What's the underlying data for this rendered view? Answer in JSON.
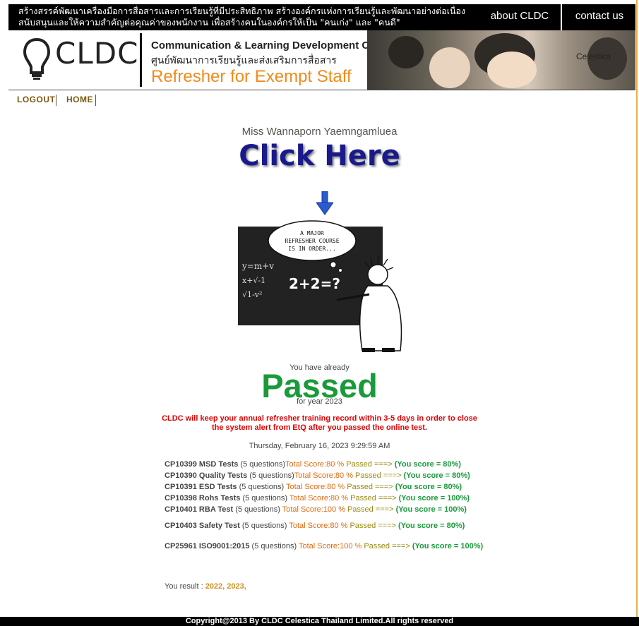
{
  "topbar": {
    "slogan_line1": "สร้างสรรค์พัฒนาเครื่องมือการสื่อสารและการเรียนรู้ที่มีประสิทธิภาพ สร้างองค์กรแห่งการเรียนรู้และพัฒนาอย่างต่อเนื่อง",
    "slogan_line2": "สนับสนุนและให้ความสำคัญต่อคุณค่าของพนักงาน เพื่อสร้างคนในองค์กรให้เป็น \"คนเก่ง\" และ \"คนดี\"",
    "about_label": "about CLDC",
    "contact_label": "contact us"
  },
  "header": {
    "logo_text": "CLDC",
    "title_en": "Communication & Learning Development Center",
    "title_th": "ศูนย์พัฒนาการเรียนรู้และส่งเสริมการสื่อสาร",
    "subtitle": "Refresher for Exempt Staff",
    "photo_caption": "Celestica"
  },
  "nav": {
    "logout_label": "LOGOUT",
    "home_label": "HOME"
  },
  "main": {
    "user_name": "Miss Wannaporn Yaemngamluea",
    "click_here": "Click Here",
    "cartoon_bubble": "A MAJOR REFRESHER COURSE IS IN ORDER...",
    "cartoon_board": "2+2=?",
    "already_text": "You have already",
    "passed_text": "Passed",
    "year_text": "for year 2023",
    "note_line1": "CLDC will keep your annual refresher training record within 3-5 days in order to close",
    "note_line2": "the system alert from EtQ after you passed the online test.",
    "datetime": "Thursday, February 16, 2023 9:29:59 AM"
  },
  "results": [
    {
      "code": "CP10399 MSD Tests",
      "questions": " (5 questions)",
      "score": "Total Score:80 %",
      "passed": " Passed ===>",
      "you": " (You score = 80%)"
    },
    {
      "code": "CP10390 Quality Tests",
      "questions": " (5 questions)",
      "score": "Total Score:80 %",
      "passed": " Passed ===>",
      "you": " (You score = 80%)"
    },
    {
      "code": "CP10391 ESD Tests",
      "questions": " (5 questions)",
      "score": " Total Score:80 %",
      "passed": " Passed ===>",
      "you": "  (You score = 80%)"
    },
    {
      "code": "CP10398 Rohs Tests",
      "questions": " (5 questions)",
      "score": " Total Score:80 %",
      "passed": " Passed ===>",
      "you": " (You score = 100%)"
    },
    {
      "code": "CP10401 RBA Test",
      "questions": " (5 questions)",
      "score": " Total Score:100 %",
      "passed": " Passed ===>",
      "you": " (You score = 100%)"
    },
    {
      "code": "CP10403 Safety Test",
      "questions": " (5 questions)",
      "score": " Total Score:80 %",
      "passed": " Passed ===>",
      "you": " (You score = 80%)"
    },
    {
      "code": "CP25961 ISO9001:2015",
      "questions": " (5 questions)",
      "score": " Total Score:100 %",
      "passed": " Passed ===>",
      "you": " (You score = 100%)"
    }
  ],
  "summary": {
    "label": "You result : ",
    "value": "2022, 2023,"
  },
  "footer": {
    "copyright": "Copyright@2013 By CLDC Celestica Thailand Limited.All rights reserved"
  }
}
